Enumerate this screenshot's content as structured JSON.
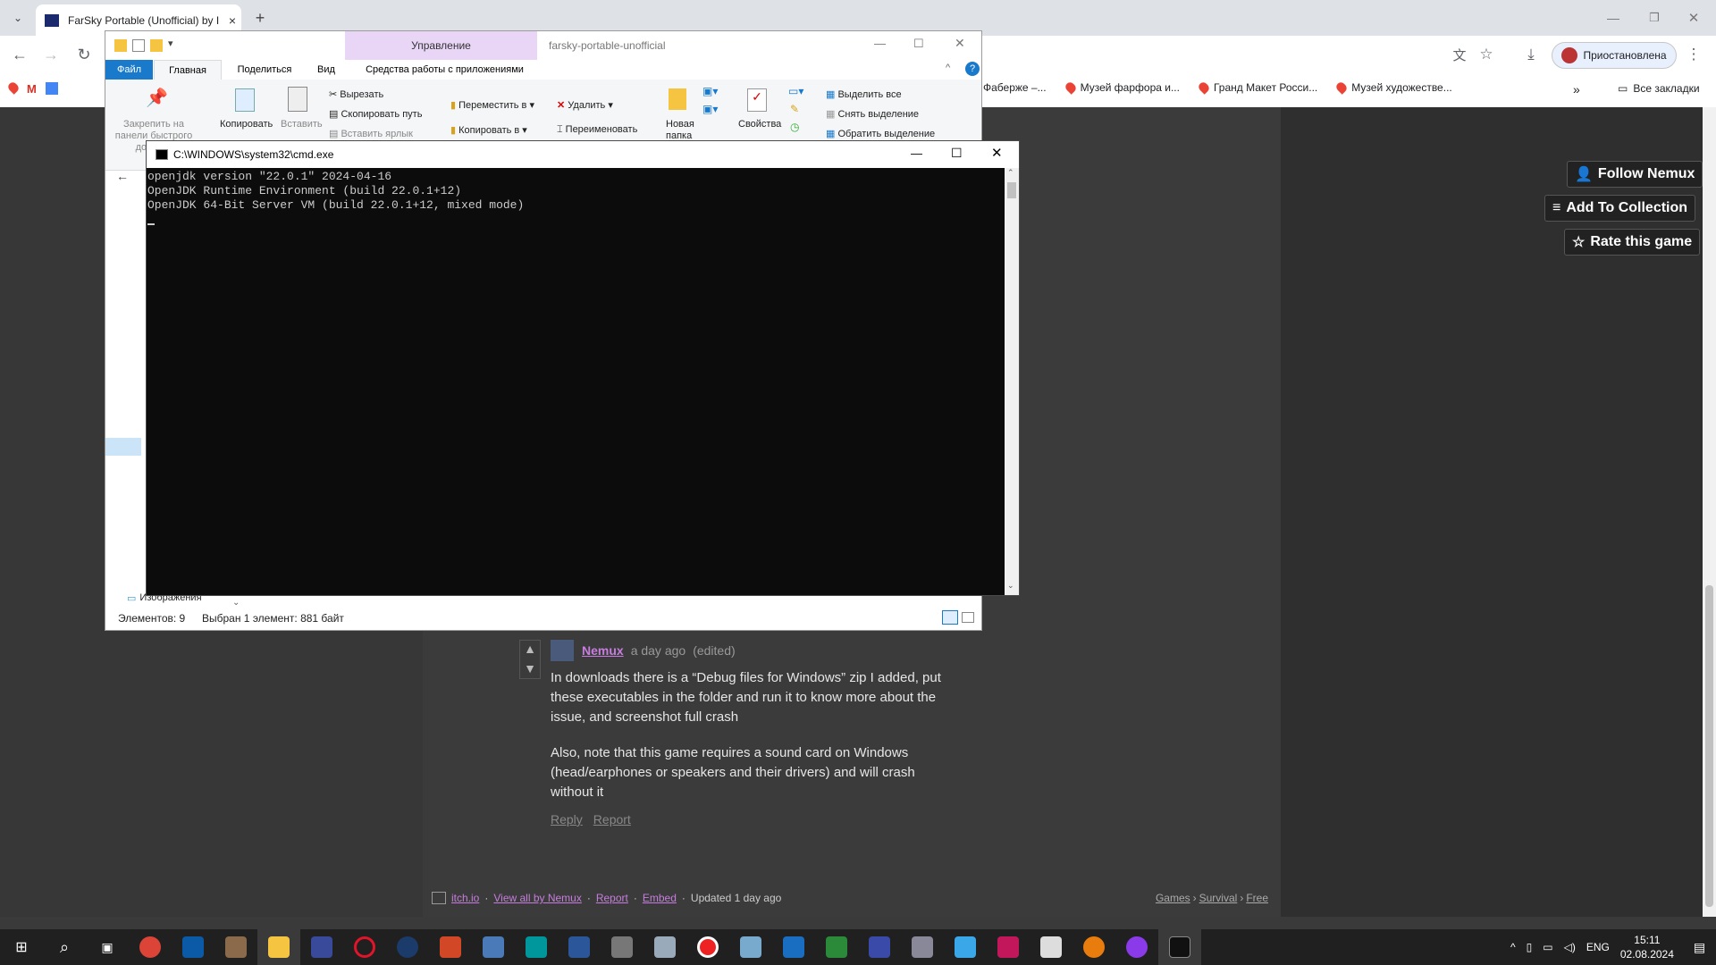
{
  "browser": {
    "tab_title": "FarSky Portable (Unofficial) by I",
    "tab_close": "×",
    "new_tab": "+",
    "profile_label": "Приостановлена",
    "bookmarks": [
      "Фаберже –...",
      "Музей фарфора и...",
      "Гранд Макет Росси...",
      "Музей художестве..."
    ],
    "more_bookmarks": "»",
    "all_bookmarks": "Все закладки"
  },
  "itch": {
    "follow_label": "Follow Nemux",
    "collection_label": "Add To Collection",
    "rate_label": "Rate this game"
  },
  "comment": {
    "author": "Nemux",
    "meta": "a day ago",
    "edited": "(edited)",
    "paragraph1": "In downloads there is a “Debug files for Windows” zip I added, put these executables in the folder and run it to know more about the issue, and screenshot full crash",
    "paragraph2": "Also, note that this game requires a sound card on Windows (head/earphones or speakers and their drivers) and will crash without it",
    "reply": "Reply",
    "report": "Report"
  },
  "footer": {
    "itchio": "itch.io",
    "view_all": "View all by Nemux",
    "report": "Report",
    "embed": "Embed",
    "updated": "Updated 1 day ago",
    "crumbs": [
      "Games",
      "Survival",
      "Free"
    ],
    "sep": "›",
    "dot": "·"
  },
  "explorer": {
    "manage_tab": "Управление",
    "folder_name": "farsky-portable-unofficial",
    "tabs": [
      "Файл",
      "Главная",
      "Поделиться",
      "Вид",
      "Средства работы с приложениями"
    ],
    "pin_label": "Закрепить на панели быстрого доступа",
    "copy_label": "Копировать",
    "paste_label": "Вставить",
    "cut": "Вырезать",
    "copy_path": "Скопировать путь",
    "paste_shortcut": "Вставить ярлык",
    "move_to": "Переместить в",
    "copy_to": "Копировать в",
    "delete": "Удалить",
    "rename": "Переименовать",
    "new_folder": "Новая папка",
    "properties": "Свойства",
    "select_all": "Выделить все",
    "deselect": "Снять выделение",
    "invert": "Обратить выделение",
    "nav_item": "Изображения",
    "status_count": "Элементов: 9",
    "status_selected": "Выбран 1 элемент: 881 байт"
  },
  "cmd": {
    "title": "C:\\WINDOWS\\system32\\cmd.exe",
    "lines": [
      "openjdk version \"22.0.1\" 2024-04-16",
      "OpenJDK Runtime Environment (build 22.0.1+12)",
      "OpenJDK 64-Bit Server VM (build 22.0.1+12, mixed mode)"
    ]
  },
  "taskbar": {
    "lang": "ENG",
    "time": "15:11",
    "date": "02.08.2024"
  },
  "colors": {
    "accent_link": "#c67ddd",
    "file_tab": "#1979ca",
    "manage_tab": "#e9d6f7"
  }
}
